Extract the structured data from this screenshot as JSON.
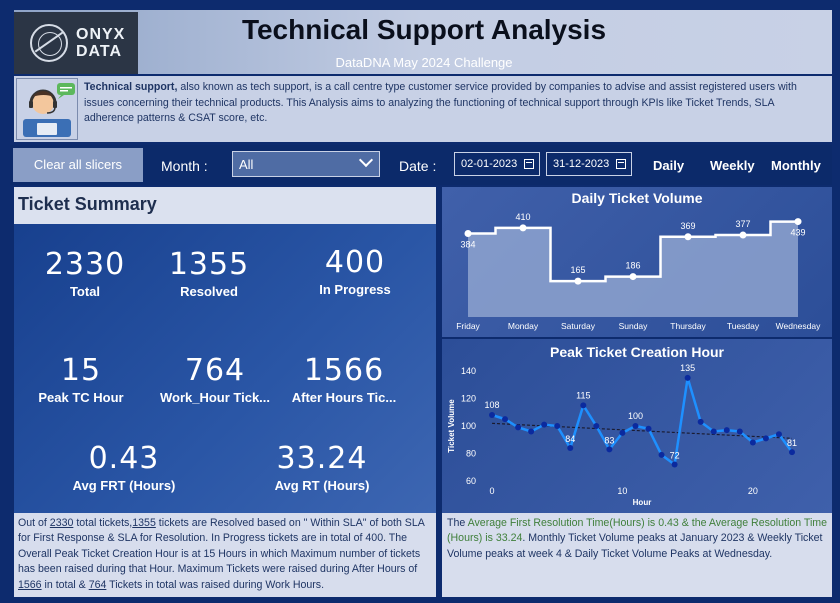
{
  "header": {
    "logo_line1": "ONYX",
    "logo_line2": "DATA",
    "title": "Technical Support Analysis",
    "subtitle": "DataDNA May 2024 Challenge"
  },
  "description": {
    "bold": "Technical support,",
    "text": " also known as tech support, is a call centre type customer service provided by companies to advise and assist registered users with issues concerning their technical products. This Analysis aims to analyzing the functioning of technical support through KPIs like Ticket Trends, SLA adherence patterns & CSAT score, etc."
  },
  "filters": {
    "clear_label": "Clear all slicers",
    "month_label": "Month :",
    "month_value": "All",
    "date_label": "Date :",
    "date_from": "02-01-2023",
    "date_to": "31-12-2023",
    "period_daily": "Daily",
    "period_weekly": "Weekly",
    "period_monthly": "Monthly"
  },
  "summary": {
    "title": "Ticket Summary",
    "kpis": [
      {
        "value": "2330",
        "label": "Total"
      },
      {
        "value": "1355",
        "label": "Resolved"
      },
      {
        "value": "400",
        "label": "In Progress"
      },
      {
        "value": "15",
        "label": "Peak TC Hour"
      },
      {
        "value": "764",
        "label": "Work_Hour Tick..."
      },
      {
        "value": "1566",
        "label": "After Hours Tic..."
      },
      {
        "value": "0.43",
        "label": "Avg FRT (Hours)"
      },
      {
        "value": "33.24",
        "label": "Avg RT (Hours)"
      }
    ]
  },
  "left_note": {
    "p1": "Out of ",
    "total": "2330",
    "p2": " total tickets,",
    "resolved": "1355",
    "p3": " tickets are Resolved based on \" Within SLA\" of both SLA for First Response & SLA for Resolution. In Progress tickets are in total of ",
    "inprog": "400",
    "p4": ". The Overall Peak Ticket Creation Hour is at ",
    "peak": "15",
    "p5": " Hours in which Maximum number of tickets has been raised during that Hour. Maximum Tickets were raised during After Hours of ",
    "after": "1566",
    "p6": " in total & ",
    "work": "764",
    "p7": " Tickets in total was raised during Work Hours."
  },
  "right_note": {
    "p1": "The ",
    "g1": "Average First Resolution Time(Hours) is ",
    "frt": "0.43",
    "g2": " & the Average Resolution Time (Hours) is ",
    "rt": "33.24",
    "p2": ". Monthly Ticket Volume peaks at January 2023 & Weekly Ticket Volume peaks at week 4 & Daily Ticket Volume Peaks at Wednesday."
  },
  "colors": {
    "background": "#0d2b6e",
    "panel": "#2a56a6",
    "line": "#1e90ff",
    "highlight_text": "#3f7f3a"
  },
  "chart_data": [
    {
      "type": "area",
      "title": "Daily Ticket Volume",
      "categories": [
        "Friday",
        "Monday",
        "Saturday",
        "Sunday",
        "Thursday",
        "Tuesday",
        "Wednesday"
      ],
      "values": [
        384,
        410,
        165,
        186,
        369,
        377,
        439
      ],
      "step": true
    },
    {
      "type": "line",
      "title": "Peak Ticket Creation Hour",
      "xlabel": "Hour",
      "ylabel": "Ticket Volume",
      "ylim": [
        60,
        140
      ],
      "yticks": [
        60,
        80,
        100,
        120,
        140
      ],
      "xticks": [
        0,
        10,
        20
      ],
      "x": [
        0,
        1,
        2,
        3,
        4,
        5,
        6,
        7,
        8,
        9,
        10,
        11,
        12,
        13,
        14,
        15,
        16,
        17,
        18,
        19,
        20,
        21,
        22,
        23
      ],
      "values": [
        108,
        105,
        99,
        96,
        101,
        100,
        84,
        115,
        100,
        83,
        95,
        100,
        98,
        79,
        72,
        135,
        103,
        96,
        97,
        96,
        88,
        91,
        94,
        81
      ],
      "labels": {
        "0": "108",
        "6": "84",
        "7": "115",
        "9": "83",
        "11": "100",
        "14": "72",
        "15": "135",
        "23": "81"
      },
      "trendline": true
    }
  ]
}
